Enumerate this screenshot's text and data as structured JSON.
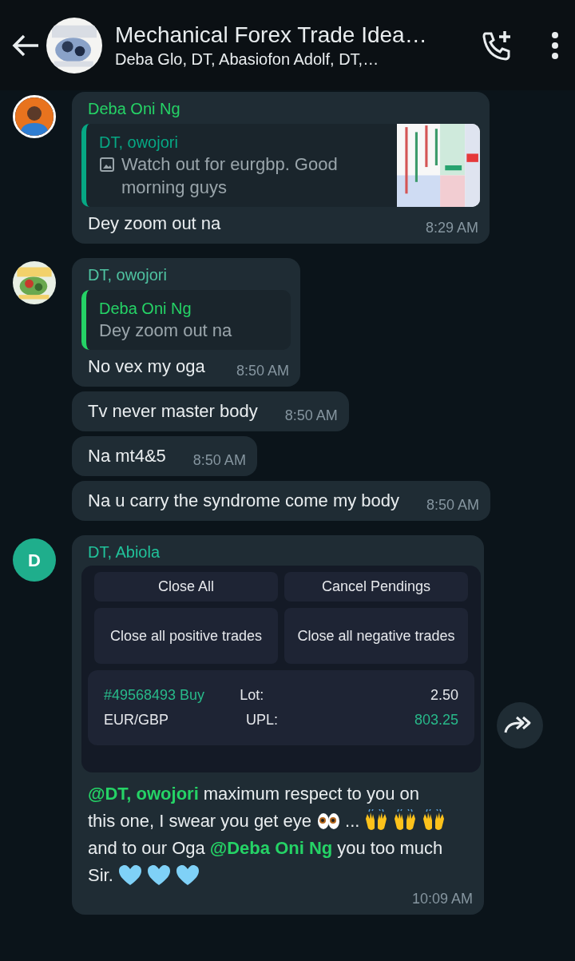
{
  "header": {
    "title": "Mechanical Forex Trade Idea…",
    "subtitle": "Deba Glo, DT, Abasiofon Adolf, DT,…",
    "avatar": {
      "kind": "picture"
    }
  },
  "messages": [
    {
      "sender": {
        "name": "Deba Oni Ng",
        "color": "#25d366"
      },
      "avatar": {
        "kind": "person"
      },
      "quote": {
        "sender": "DT, owojori",
        "color": "#06a884",
        "text": "Watch out for eurgbp. Good morning guys",
        "has_image": true
      },
      "segments": [
        {
          "kind": "text",
          "text": "Dey zoom out na"
        }
      ],
      "time": "8:29 AM"
    },
    {
      "sender": {
        "name": "DT, owojori",
        "color": "#4fc3a1"
      },
      "avatar": {
        "kind": "picture"
      },
      "quote": {
        "sender": "Deba Oni Ng",
        "color": "#25d366",
        "text": "Dey zoom out na"
      },
      "segments": [
        {
          "kind": "text",
          "text": "No vex my oga"
        }
      ],
      "time": "8:50 AM"
    },
    {
      "segments": [
        {
          "kind": "text",
          "text": "Tv never master body"
        }
      ],
      "time": "8:50 AM"
    },
    {
      "segments": [
        {
          "kind": "text",
          "text": "Na mt4&5"
        }
      ],
      "time": "8:50 AM"
    },
    {
      "segments": [
        {
          "kind": "text",
          "text": "Na u carry the syndrome come my body"
        }
      ],
      "time": "8:50 AM"
    },
    {
      "sender": {
        "name": "DT, Abiola",
        "color": "#21c29a"
      },
      "avatar": {
        "kind": "letter",
        "initial": "D",
        "color": "#1fae8c"
      },
      "forward_button": true,
      "attachment": {
        "buttons": [
          "Close All",
          "Cancel Pendings",
          "Close all positive trades",
          "Close all negative trades"
        ],
        "position": {
          "ticket": "#49568493 Buy",
          "symbol": "EUR/GBP",
          "lot_label": "Lot:",
          "lot": "2.50",
          "upl_label": "UPL:",
          "upl": "803.25"
        }
      },
      "lines": [
        [
          {
            "kind": "mention",
            "text": "@DT, owojori"
          },
          {
            "kind": "text",
            "text": "maximum respect to you on"
          }
        ],
        [
          {
            "kind": "text",
            "text": "this one, I swear you get eye"
          },
          {
            "kind": "eyes"
          },
          {
            "kind": "text",
            "text": "..."
          },
          {
            "kind": "hands"
          },
          {
            "kind": "hands"
          },
          {
            "kind": "hands"
          }
        ],
        [
          {
            "kind": "text",
            "text": "and to our Oga"
          },
          {
            "kind": "mention",
            "text": "@Deba Oni Ng"
          },
          {
            "kind": "text",
            "text": "you too much"
          }
        ],
        [
          {
            "kind": "text",
            "text": "Sir."
          },
          {
            "kind": "heart"
          },
          {
            "kind": "heart"
          },
          {
            "kind": "heart"
          }
        ]
      ],
      "time": "10:09 AM"
    }
  ]
}
